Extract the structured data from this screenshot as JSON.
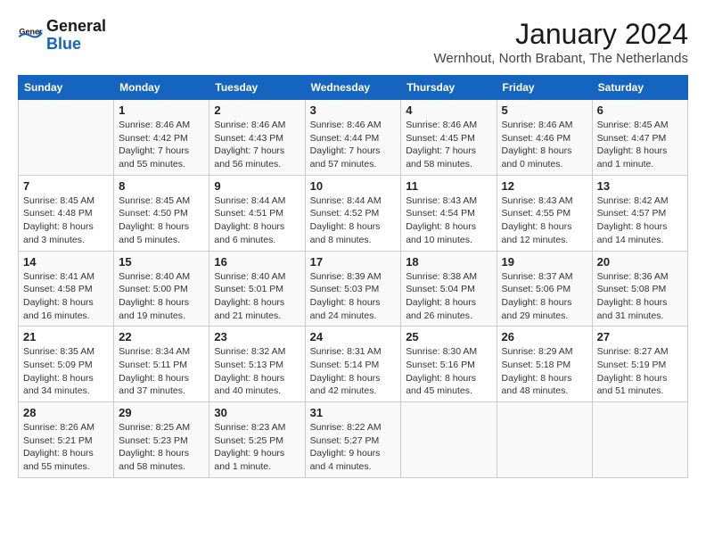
{
  "header": {
    "logo_general": "General",
    "logo_blue": "Blue",
    "month_title": "January 2024",
    "location": "Wernhout, North Brabant, The Netherlands"
  },
  "days_of_week": [
    "Sunday",
    "Monday",
    "Tuesday",
    "Wednesday",
    "Thursday",
    "Friday",
    "Saturday"
  ],
  "weeks": [
    [
      {
        "day": "",
        "details": ""
      },
      {
        "day": "1",
        "details": "Sunrise: 8:46 AM\nSunset: 4:42 PM\nDaylight: 7 hours\nand 55 minutes."
      },
      {
        "day": "2",
        "details": "Sunrise: 8:46 AM\nSunset: 4:43 PM\nDaylight: 7 hours\nand 56 minutes."
      },
      {
        "day": "3",
        "details": "Sunrise: 8:46 AM\nSunset: 4:44 PM\nDaylight: 7 hours\nand 57 minutes."
      },
      {
        "day": "4",
        "details": "Sunrise: 8:46 AM\nSunset: 4:45 PM\nDaylight: 7 hours\nand 58 minutes."
      },
      {
        "day": "5",
        "details": "Sunrise: 8:46 AM\nSunset: 4:46 PM\nDaylight: 8 hours\nand 0 minutes."
      },
      {
        "day": "6",
        "details": "Sunrise: 8:45 AM\nSunset: 4:47 PM\nDaylight: 8 hours\nand 1 minute."
      }
    ],
    [
      {
        "day": "7",
        "details": "Sunrise: 8:45 AM\nSunset: 4:48 PM\nDaylight: 8 hours\nand 3 minutes."
      },
      {
        "day": "8",
        "details": "Sunrise: 8:45 AM\nSunset: 4:50 PM\nDaylight: 8 hours\nand 5 minutes."
      },
      {
        "day": "9",
        "details": "Sunrise: 8:44 AM\nSunset: 4:51 PM\nDaylight: 8 hours\nand 6 minutes."
      },
      {
        "day": "10",
        "details": "Sunrise: 8:44 AM\nSunset: 4:52 PM\nDaylight: 8 hours\nand 8 minutes."
      },
      {
        "day": "11",
        "details": "Sunrise: 8:43 AM\nSunset: 4:54 PM\nDaylight: 8 hours\nand 10 minutes."
      },
      {
        "day": "12",
        "details": "Sunrise: 8:43 AM\nSunset: 4:55 PM\nDaylight: 8 hours\nand 12 minutes."
      },
      {
        "day": "13",
        "details": "Sunrise: 8:42 AM\nSunset: 4:57 PM\nDaylight: 8 hours\nand 14 minutes."
      }
    ],
    [
      {
        "day": "14",
        "details": "Sunrise: 8:41 AM\nSunset: 4:58 PM\nDaylight: 8 hours\nand 16 minutes."
      },
      {
        "day": "15",
        "details": "Sunrise: 8:40 AM\nSunset: 5:00 PM\nDaylight: 8 hours\nand 19 minutes."
      },
      {
        "day": "16",
        "details": "Sunrise: 8:40 AM\nSunset: 5:01 PM\nDaylight: 8 hours\nand 21 minutes."
      },
      {
        "day": "17",
        "details": "Sunrise: 8:39 AM\nSunset: 5:03 PM\nDaylight: 8 hours\nand 24 minutes."
      },
      {
        "day": "18",
        "details": "Sunrise: 8:38 AM\nSunset: 5:04 PM\nDaylight: 8 hours\nand 26 minutes."
      },
      {
        "day": "19",
        "details": "Sunrise: 8:37 AM\nSunset: 5:06 PM\nDaylight: 8 hours\nand 29 minutes."
      },
      {
        "day": "20",
        "details": "Sunrise: 8:36 AM\nSunset: 5:08 PM\nDaylight: 8 hours\nand 31 minutes."
      }
    ],
    [
      {
        "day": "21",
        "details": "Sunrise: 8:35 AM\nSunset: 5:09 PM\nDaylight: 8 hours\nand 34 minutes."
      },
      {
        "day": "22",
        "details": "Sunrise: 8:34 AM\nSunset: 5:11 PM\nDaylight: 8 hours\nand 37 minutes."
      },
      {
        "day": "23",
        "details": "Sunrise: 8:32 AM\nSunset: 5:13 PM\nDaylight: 8 hours\nand 40 minutes."
      },
      {
        "day": "24",
        "details": "Sunrise: 8:31 AM\nSunset: 5:14 PM\nDaylight: 8 hours\nand 42 minutes."
      },
      {
        "day": "25",
        "details": "Sunrise: 8:30 AM\nSunset: 5:16 PM\nDaylight: 8 hours\nand 45 minutes."
      },
      {
        "day": "26",
        "details": "Sunrise: 8:29 AM\nSunset: 5:18 PM\nDaylight: 8 hours\nand 48 minutes."
      },
      {
        "day": "27",
        "details": "Sunrise: 8:27 AM\nSunset: 5:19 PM\nDaylight: 8 hours\nand 51 minutes."
      }
    ],
    [
      {
        "day": "28",
        "details": "Sunrise: 8:26 AM\nSunset: 5:21 PM\nDaylight: 8 hours\nand 55 minutes."
      },
      {
        "day": "29",
        "details": "Sunrise: 8:25 AM\nSunset: 5:23 PM\nDaylight: 8 hours\nand 58 minutes."
      },
      {
        "day": "30",
        "details": "Sunrise: 8:23 AM\nSunset: 5:25 PM\nDaylight: 9 hours\nand 1 minute."
      },
      {
        "day": "31",
        "details": "Sunrise: 8:22 AM\nSunset: 5:27 PM\nDaylight: 9 hours\nand 4 minutes."
      },
      {
        "day": "",
        "details": ""
      },
      {
        "day": "",
        "details": ""
      },
      {
        "day": "",
        "details": ""
      }
    ]
  ]
}
